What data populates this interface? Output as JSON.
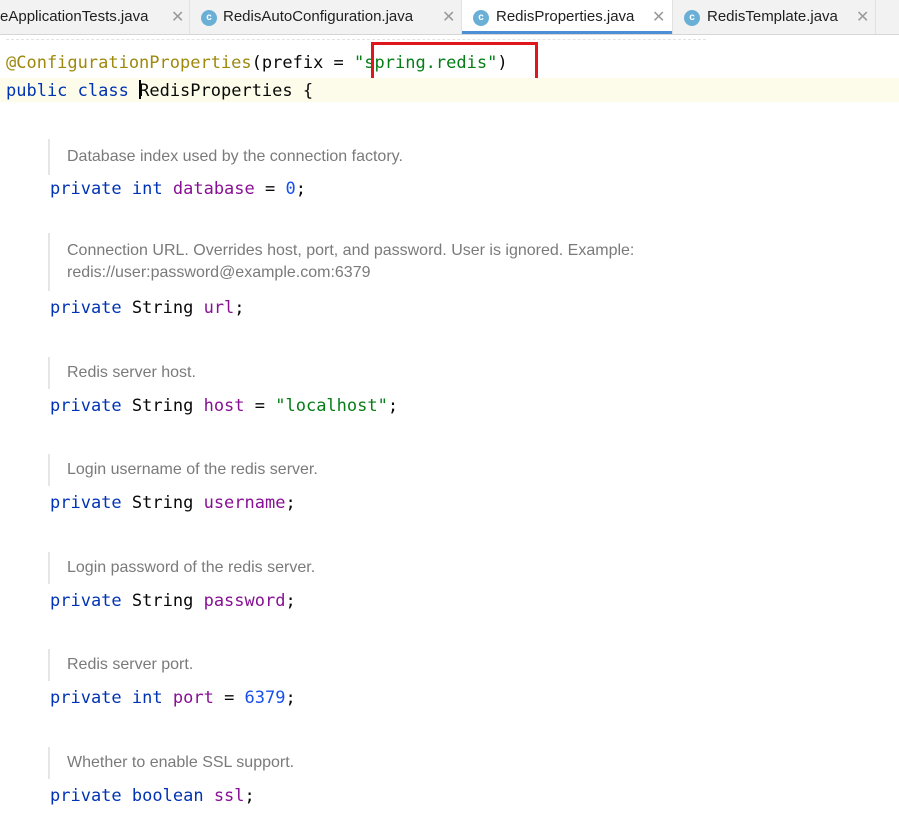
{
  "tabs": [
    {
      "label": "eApplicationTests.java",
      "active": false,
      "icon": "class-icon"
    },
    {
      "label": "RedisAutoConfiguration.java",
      "active": false,
      "icon": "class-icon"
    },
    {
      "label": "RedisProperties.java",
      "active": true,
      "icon": "class-icon"
    },
    {
      "label": "RedisTemplate.java",
      "active": false,
      "icon": "class-icon"
    }
  ],
  "icons": {
    "class_glyph": "c",
    "close_glyph": "✕"
  },
  "code": {
    "annotation": {
      "name": "@ConfigurationProperties",
      "open": "(",
      "param": "prefix",
      "eq": " = ",
      "value": "\"spring.redis\"",
      "close": ")"
    },
    "class_decl": {
      "kw1": "public",
      "kw2": "class",
      "name": "RedisProperties",
      "brace": "{"
    },
    "fields": [
      {
        "doc": "Database index used by the connection factory.",
        "modifier": "private",
        "type": "int",
        "name": "database",
        "eq": " = ",
        "value": "0",
        "value_kind": "num",
        "semi": ";"
      },
      {
        "doc": "Connection URL. Overrides host, port, and password. User is ignored. Example: redis://user:password@example.com:6379",
        "modifier": "private",
        "type": "String",
        "name": "url",
        "semi": ";"
      },
      {
        "doc": "Redis server host.",
        "modifier": "private",
        "type": "String",
        "name": "host",
        "eq": " = ",
        "value": "\"localhost\"",
        "value_kind": "str",
        "semi": ";"
      },
      {
        "doc": "Login username of the redis server.",
        "modifier": "private",
        "type": "String",
        "name": "username",
        "semi": ";"
      },
      {
        "doc": "Login password of the redis server.",
        "modifier": "private",
        "type": "String",
        "name": "password",
        "semi": ";"
      },
      {
        "doc": "Redis server port.",
        "modifier": "private",
        "type": "int",
        "name": "port",
        "eq": " = ",
        "value": "6379",
        "value_kind": "num",
        "semi": ";"
      },
      {
        "doc": "Whether to enable SSL support.",
        "modifier": "private",
        "type": "boolean",
        "name": "ssl",
        "semi": ";"
      }
    ]
  },
  "colors": {
    "keyword": "#0033b3",
    "annotation": "#9e880d",
    "string": "#067d17",
    "number": "#1750eb",
    "field": "#871094",
    "doc_text": "#7a7a7a",
    "highlight_box": "#e0161d",
    "active_tab_underline": "#4d8fd6"
  }
}
